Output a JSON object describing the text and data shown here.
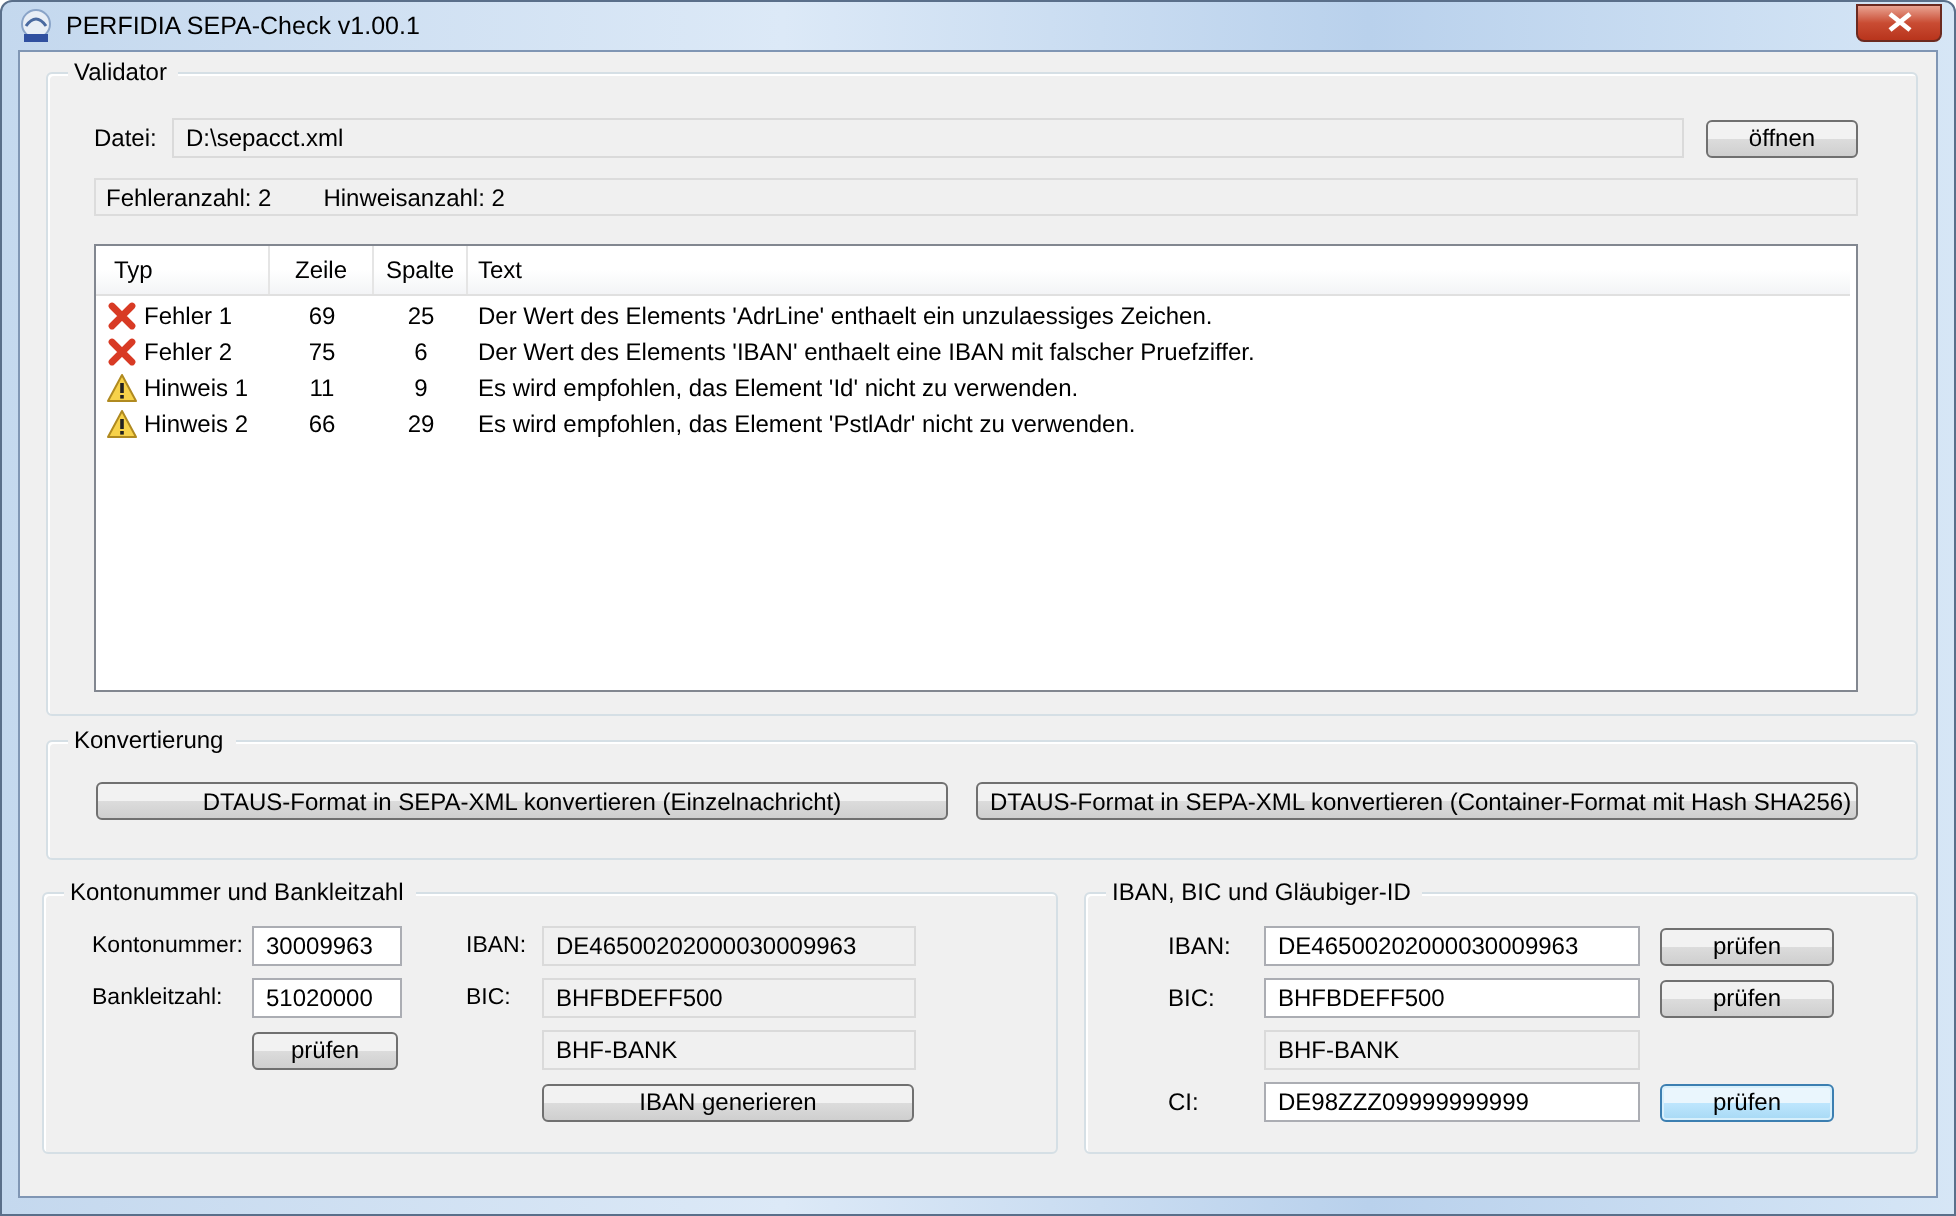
{
  "window": {
    "title": "PERFIDIA SEPA-Check v1.00.1"
  },
  "validator": {
    "title": "Validator",
    "file_label": "Datei:",
    "file_value": "D:\\sepacct.xml",
    "open_button": "öffnen",
    "error_count": "Fehleranzahl: 2",
    "hint_count": "Hinweisanzahl: 2",
    "columns": [
      "Typ",
      "Zeile",
      "Spalte",
      "Text"
    ],
    "rows": [
      {
        "kind": "error",
        "type": "Fehler 1",
        "line": "69",
        "column": "25",
        "text": "Der Wert des Elements 'AdrLine' enthaelt ein unzulaessiges Zeichen."
      },
      {
        "kind": "error",
        "type": "Fehler 2",
        "line": "75",
        "column": "6",
        "text": "Der Wert des Elements 'IBAN' enthaelt eine IBAN mit falscher Pruefziffer."
      },
      {
        "kind": "warning",
        "type": "Hinweis 1",
        "line": "11",
        "column": "9",
        "text": "Es wird empfohlen, das Element 'Id' nicht zu verwenden."
      },
      {
        "kind": "warning",
        "type": "Hinweis 2",
        "line": "66",
        "column": "29",
        "text": "Es wird empfohlen, das Element 'PstlAdr' nicht zu verwenden."
      }
    ]
  },
  "conversion": {
    "title": "Konvertierung",
    "buttons": [
      "DTAUS-Format in SEPA-XML konvertieren (Einzelnachricht)",
      "DTAUS-Format in SEPA-XML konvertieren (Container-Format mit Hash SHA256)"
    ]
  },
  "account": {
    "title": "Kontonummer und Bankleitzahl",
    "account_label": "Kontonummer:",
    "account_value": "30009963",
    "bank_code_label": "Bankleitzahl:",
    "bank_code_value": "51020000",
    "check_button": "prüfen",
    "iban_label": "IBAN:",
    "iban_value": "DE46500202000030009963",
    "bic_label": "BIC:",
    "bic_value": "BHFBDEFF500",
    "bank_name": "BHF-BANK",
    "generate_button": "IBAN generieren"
  },
  "iban_check": {
    "title": "IBAN, BIC und Gläubiger-ID",
    "rows": [
      {
        "kind": "input",
        "label": "IBAN:",
        "value": "DE46500202000030009963",
        "button": "prüfen",
        "focused": false
      },
      {
        "kind": "input",
        "label": "BIC:",
        "value": "BHFBDEFF500",
        "button": "prüfen",
        "focused": false
      },
      {
        "kind": "readonly",
        "value": "BHF-BANK"
      },
      {
        "kind": "input",
        "label": "CI:",
        "value": "DE98ZZZ09999999999",
        "button": "prüfen",
        "focused": true
      }
    ]
  }
}
